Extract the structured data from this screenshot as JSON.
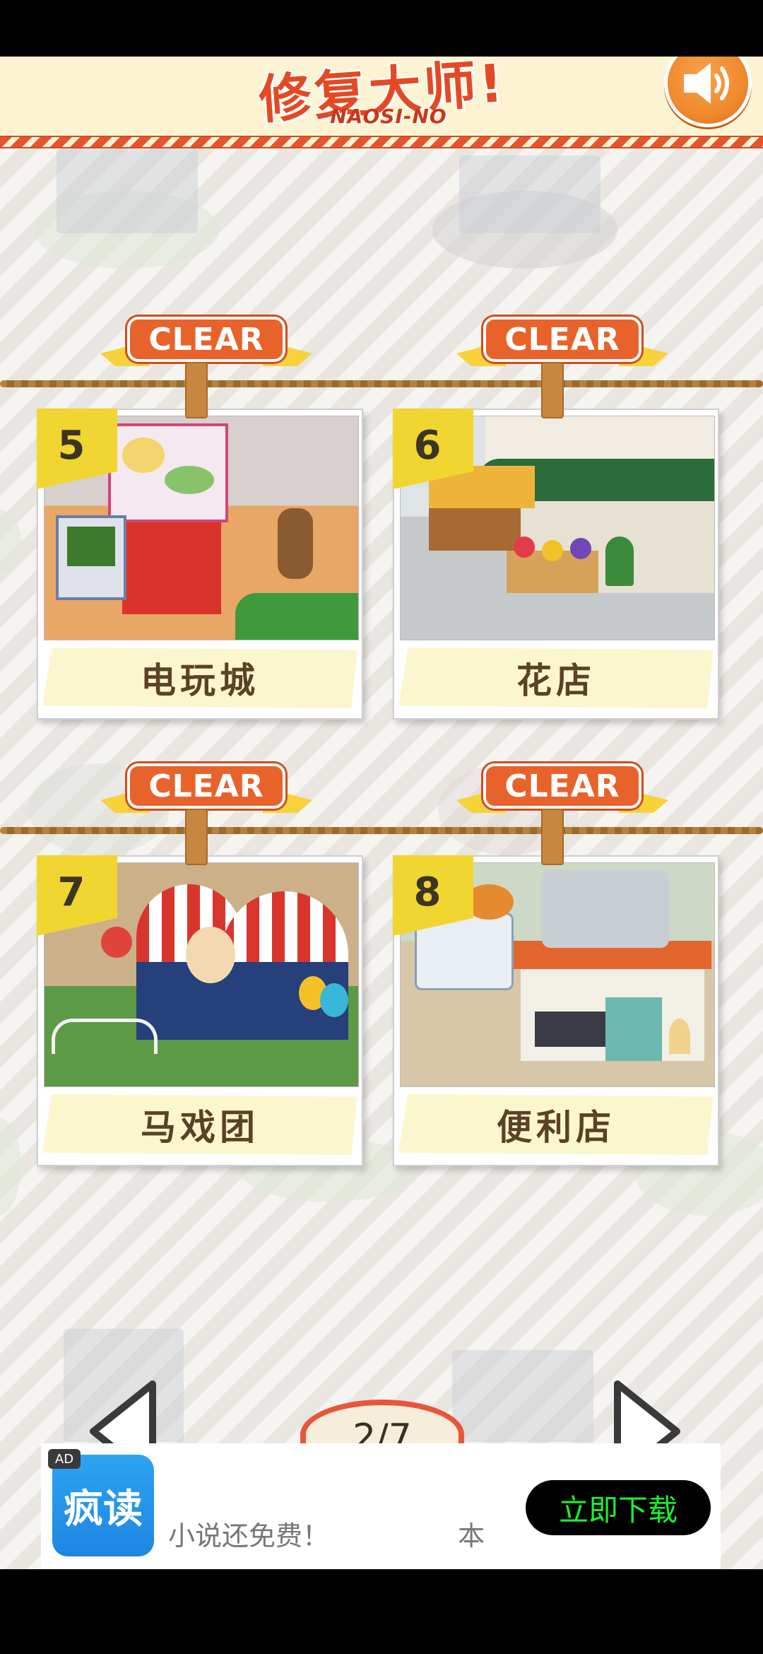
{
  "header": {
    "logo_cn": "修复大师!",
    "logo_en": "NAOSI-NO",
    "sound_icon": "speaker-icon"
  },
  "clear_label": "CLEAR",
  "levels": [
    {
      "number": "5",
      "name": "电玩城",
      "cleared": true
    },
    {
      "number": "6",
      "name": "花店",
      "cleared": true
    },
    {
      "number": "7",
      "name": "马戏团",
      "cleared": true
    },
    {
      "number": "8",
      "name": "便利店",
      "cleared": true
    }
  ],
  "pagination": {
    "current": "2/7",
    "prev_icon": "triangle-left-icon",
    "next_icon": "triangle-right-icon"
  },
  "ad": {
    "badge": "AD",
    "app_icon_text": "疯读",
    "text": "小说还免费！",
    "text_extra": "本",
    "cta": "立即下载"
  },
  "colors": {
    "accent_orange": "#e8632b",
    "ribbon_yellow": "#f7d23a",
    "badge_yellow": "#f1d531",
    "cta_green": "#1df02a"
  }
}
